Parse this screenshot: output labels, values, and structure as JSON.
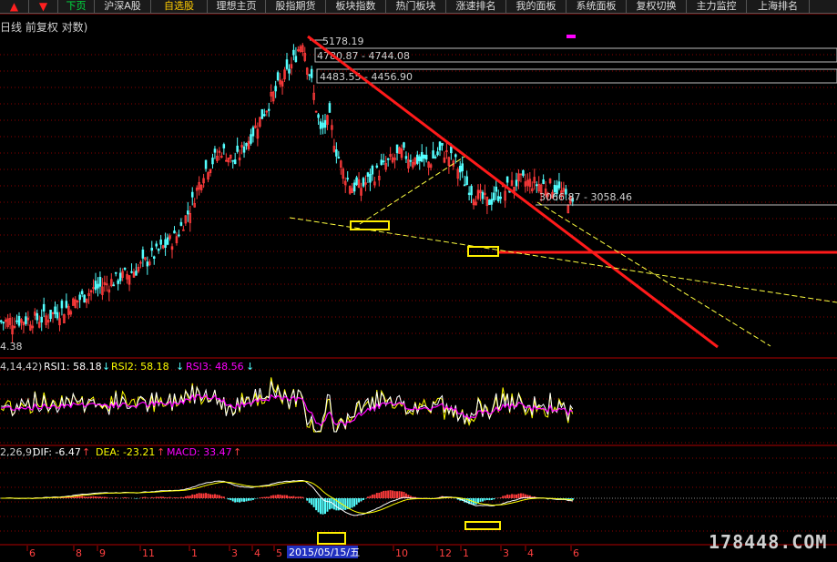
{
  "toolbar": {
    "buttons": [
      "▲",
      "▼",
      "下页",
      "沪深A股",
      "自选股",
      "理想主页",
      "股指期货",
      "板块指数",
      "热门板块",
      "涨速排名",
      "我的面板",
      "系统面板",
      "复权切换",
      "主力监控",
      "上海排名"
    ]
  },
  "main_panel": {
    "title": "日线 前复权 对数)",
    "low_label": "4.38",
    "levels": [
      "5178.19",
      "4780.87 - 4744.08",
      "4483.55 - 4456.90",
      "3066.87 - 3058.46"
    ]
  },
  "rsi_panel": {
    "prefix": "4,14,42)",
    "rsi1": "RSI1: 58.18",
    "rsi2": "RSI2: 58.18",
    "rsi3": "RSI3: 48.56"
  },
  "macd_panel": {
    "prefix": "2,26,9)",
    "dif": "DIF: -6.47",
    "dea": "DEA: -23.21",
    "macd": "MACD: 33.47"
  },
  "x_axis": {
    "labels": [
      "6",
      "8",
      "9",
      "11",
      "1",
      "3",
      "4",
      "5",
      "2015/05/15/五",
      "10",
      "12",
      "1",
      "3",
      "4",
      "6"
    ]
  },
  "watermark": "178448.COM",
  "colors": {
    "up": "#ff3b3b",
    "down": "#54ffff",
    "trendline_red": "#ff1a1a",
    "trendline_yellow": "#ffff40",
    "rsi1": "#ffffff",
    "rsi2": "#ffff00",
    "rsi3": "#ff00ff",
    "grid": "#8b0000"
  },
  "chart_data": {
    "type": "candlestick",
    "title": "日线 前复权 对数)",
    "key_prices": {
      "peak": 5178.19,
      "resistance_1": [
        4780.87,
        4744.08
      ],
      "resistance_2": [
        4483.55,
        4456.9
      ],
      "resistance_3": [
        3066.87,
        3058.46
      ]
    },
    "x_tick_labels": [
      "6",
      "8",
      "9",
      "11",
      "1",
      "3",
      "4",
      "5",
      "2015/05/15/五",
      "10",
      "12",
      "1",
      "3",
      "4",
      "6"
    ],
    "close_path": [
      [
        0,
        0.08
      ],
      [
        18,
        0.09
      ],
      [
        28,
        0.12
      ],
      [
        40,
        0.18
      ],
      [
        52,
        0.22
      ],
      [
        60,
        0.25
      ],
      [
        70,
        0.31
      ],
      [
        78,
        0.36
      ],
      [
        84,
        0.45
      ],
      [
        90,
        0.57
      ],
      [
        98,
        0.64
      ],
      [
        104,
        0.6
      ],
      [
        112,
        0.7
      ],
      [
        118,
        0.78
      ],
      [
        124,
        0.86
      ],
      [
        128,
        0.9
      ],
      [
        132,
        0.97
      ],
      [
        134,
        1.0
      ],
      [
        138,
        0.86
      ],
      [
        142,
        0.7
      ],
      [
        146,
        0.74
      ],
      [
        149,
        0.64
      ],
      [
        152,
        0.57
      ],
      [
        156,
        0.52
      ],
      [
        160,
        0.52
      ],
      [
        166,
        0.56
      ],
      [
        172,
        0.6
      ],
      [
        178,
        0.63
      ],
      [
        184,
        0.61
      ],
      [
        190,
        0.6
      ],
      [
        196,
        0.64
      ],
      [
        202,
        0.6
      ],
      [
        206,
        0.54
      ],
      [
        210,
        0.5
      ],
      [
        216,
        0.47
      ],
      [
        222,
        0.5
      ],
      [
        230,
        0.54
      ],
      [
        238,
        0.53
      ],
      [
        246,
        0.52
      ],
      [
        252,
        0.48
      ],
      [
        254,
        0.46
      ]
    ],
    "price_top": 5178.19,
    "price_bottom": 1900,
    "rsi": {
      "rsi1": 58.18,
      "rsi2": 58.18,
      "rsi3": 48.56
    },
    "macd": {
      "dif": -6.47,
      "dea": -23.21,
      "macd": 33.47
    }
  }
}
